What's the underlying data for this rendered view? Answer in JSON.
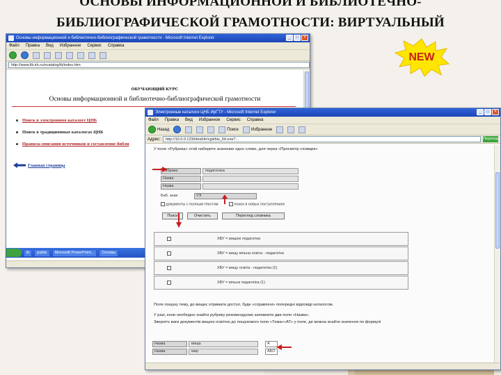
{
  "slide": {
    "title_line1": "ОСНОВЫ ИНФОРМАЦИОННОЙ И БИБЛИОТЕЧНО-",
    "title_line2": "БИБЛИОГРАФИЧЕСКОЙ ГРАМОТНОСТИ: ВИРТУАЛЬНЫЙ",
    "badge": "NEW"
  },
  "colors": {
    "title_bar": "#2052c6",
    "accent_red": "#b01e1e",
    "badge_yellow": "#ffe600"
  },
  "window1": {
    "title": "Основы информационной и библиотечно-библиографической грамотности - Microsoft Internet Explorer",
    "menu": [
      "Файл",
      "Правка",
      "Вид",
      "Избранное",
      "Сервис",
      "Справка"
    ],
    "address": "http://www.lib.irk.ru/ecatalog/ib/index.htm",
    "course_label": "ОБУЧАЮЩИЙ КУРС",
    "course_title": "Основы информационной и библиотечно-библиографической грамотности",
    "links": [
      "Поиск в электронном каталоге ЦНБ",
      "Поиск в традиционных каталогах ЦНБ",
      "Правила описания источников и составление библи"
    ],
    "back_link": "Главная страница",
    "taskbar": [
      "ib",
      "public",
      "Microsoft PowerPoint...",
      "Основы"
    ]
  },
  "window2": {
    "title": "Электронные каталоги ЦНБ ИрГТУ - Microsoft Internet Explorer",
    "menu": [
      "Файл",
      "Правка",
      "Вид",
      "Избранное",
      "Сервис",
      "Справка"
    ],
    "toolbar": [
      "Назад",
      "Поиск",
      "Избранное"
    ],
    "address_label": "Адрес:",
    "address": "http://10.0.0.123/irbis64r/cgiirbis_64.exe?...",
    "go_label": "Переход",
    "instruction": "У поле «Рубрика» этой наберите значение одно слово, для через «Просмотр словаря»",
    "fields": [
      {
        "label": "Рубрика",
        "value": "педагогика"
      },
      {
        "label": "Назва",
        "value": ""
      },
      {
        "label": "Назва",
        "value": ""
      }
    ],
    "db_label": "Биб. знак:",
    "db_value": "УЭ",
    "check1": "документы с полным текстом",
    "check2": "поиск в новых поступлениях",
    "buttons": [
      "Поиск",
      "Очистить",
      "Перегляд словника"
    ],
    "results": [
      "ХВУ = вищою педагогіка",
      "ХВУ = вищу вільна освіта - педагогіка",
      "ХВУ = вищу освіта - педагогіка (1)",
      "ХВУ = вільна педагогіка (1)"
    ],
    "para1": "Поле пошуку тему, до вищеє отримати доступ, буде «справлені» попередні відповіді каталогом.",
    "para2": "У разі, коли необхідно знайти рубрику рекомендуємо заповнити два поля «Назва».",
    "para3": "Звернітє ваги документів вищою освітою до пошукового поля «Тема»«АТ» у поле, де можна знайти значення по формулі",
    "bottom_fields": [
      {
        "label": "Назва",
        "value": "вища",
        "op": "А"
      },
      {
        "label": "Назва",
        "value": "мир",
        "op": "АБО"
      }
    ]
  }
}
